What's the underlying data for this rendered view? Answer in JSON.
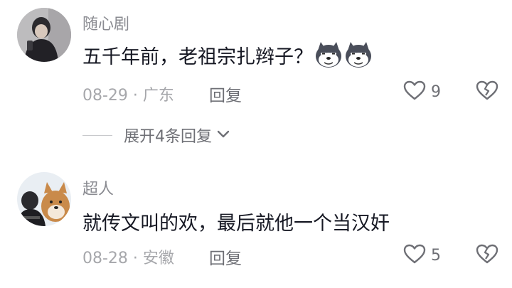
{
  "comments": [
    {
      "username": "随心剧",
      "text": "五千年前，老祖宗扎辫子？",
      "emojis": [
        "husky-emoji",
        "husky-emoji"
      ],
      "date": "08-29",
      "separator": " · ",
      "location": "广东",
      "reply_label": "回复",
      "like_count": "9",
      "expand_replies_label": "展开4条回复"
    },
    {
      "username": "超人",
      "text": "就传文叫的欢，最后就他一个当汉奸",
      "date": "08-28",
      "separator": " · ",
      "location": "安徽",
      "reply_label": "回复",
      "like_count": "5"
    }
  ],
  "colors": {
    "username": "#8a8b91",
    "text": "#161823",
    "meta": "#a6a7ab",
    "action": "#6e6f75"
  },
  "icons": [
    "heart-outline-icon",
    "broken-heart-icon",
    "chevron-down-icon"
  ]
}
